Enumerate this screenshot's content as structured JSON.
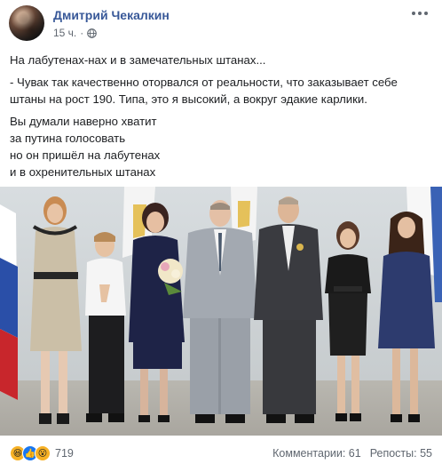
{
  "post": {
    "author": "Дмитрий Чекалкин",
    "time": "15 ч.",
    "separator": "·",
    "text": {
      "line1": "На лабутенах-нах и в замечательных штанах...",
      "line2": "- Чувак так качественно оторвался от реальности, что заказывает себе штаны на рост 190. Типа, это я высокий, а вокруг эдакие карлики.",
      "poem": [
        "Вы думали наверно хватит",
        "за путина голосовать",
        "но он пришёл на лабутенах",
        "и в охренительных штанах"
      ]
    },
    "reactions": {
      "count": "719",
      "icons": [
        "haha-icon",
        "like-icon",
        "wow-icon"
      ]
    },
    "comments": "Комментарии: 61",
    "shares": "Репосты: 55"
  },
  "colors": {
    "author": "#385898",
    "meta": "#606770",
    "like": "#1877f2",
    "emoji": "#f7b125"
  }
}
